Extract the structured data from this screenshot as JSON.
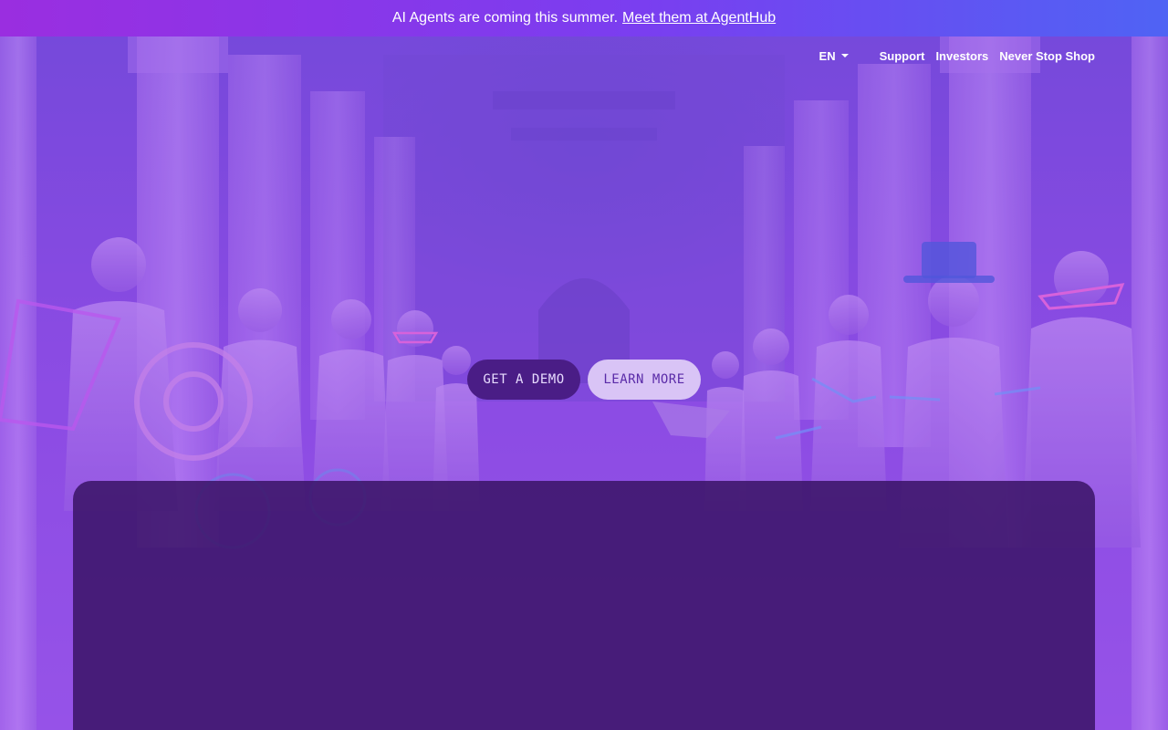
{
  "banner": {
    "text": "AI Agents are coming this summer.",
    "link_label": "Meet them at AgentHub"
  },
  "nav": {
    "language": "EN",
    "links": [
      "Support",
      "Investors",
      "Never Stop Shop"
    ]
  },
  "hero": {
    "primary_cta": "GET A DEMO",
    "secondary_cta": "LEARN MORE"
  },
  "colors": {
    "banner_start": "#9a2ee0",
    "banner_end": "#4f63f4",
    "hero_purple": "#8a4be3",
    "demo_button": "#4a1d86",
    "learn_button": "#d9c4f6",
    "panel": "#3a1466"
  }
}
